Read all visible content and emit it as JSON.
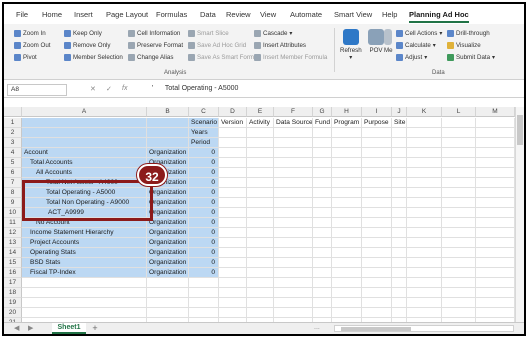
{
  "ribbon_tabs": [
    "File",
    "Home",
    "Insert",
    "Page Layout",
    "Formulas",
    "Data",
    "Review",
    "View",
    "Automate",
    "Smart View",
    "Help",
    "Planning Ad Hoc"
  ],
  "ribbon": {
    "analysis": {
      "zoom_in": "Zoom In",
      "zoom_out": "Zoom Out",
      "pivot": "Pivot",
      "keep_only": "Keep Only",
      "remove_only": "Remove Only",
      "member_selection": "Member Selection",
      "cell_information": "Cell Information",
      "preserve_format": "Preserve Format",
      "change_alias": "Change Alias",
      "smart_slice": "Smart Slice",
      "save_ad_hoc_grid": "Save Ad Hoc Grid",
      "save_as_smart_form": "Save As Smart Form",
      "cascade": "Cascade",
      "insert_attributes": "Insert Attributes",
      "insert_member_formula": "Insert Member Formula",
      "group_label": "Analysis"
    },
    "data": {
      "refresh": "Refresh",
      "pov": "POV",
      "me": "Me",
      "cell_actions": "Cell Actions",
      "calculate": "Calculate",
      "adjust": "Adjust",
      "drill_through": "Drill-through",
      "visualize": "Visualize",
      "submit_data": "Submit Data",
      "group_label": "Data"
    }
  },
  "formula_bar": {
    "name_box": "A8",
    "cancel": "✕",
    "enter": "✓",
    "fx": "fx",
    "content": "'      Total Operating - A5000"
  },
  "columns": [
    "A",
    "B",
    "C",
    "D",
    "E",
    "F",
    "G",
    "H",
    "I",
    "J",
    "K",
    "L",
    "M"
  ],
  "rows": [
    {
      "n": "1",
      "a": "",
      "b": "",
      "c": "Scenario",
      "d": "Version",
      "e": "Activity",
      "f": "Data Source",
      "g": "Fund",
      "h": "Program",
      "i": "Purpose",
      "j": "Site"
    },
    {
      "n": "2",
      "a": "",
      "b": "",
      "c": "Years"
    },
    {
      "n": "3",
      "a": "",
      "b": "",
      "c": "Period"
    },
    {
      "n": "4",
      "a": "Account",
      "b": "Organization",
      "c": "0"
    },
    {
      "n": "5",
      "a": "Total Accounts",
      "b": "Organization",
      "c": "0"
    },
    {
      "n": "6",
      "a": "All Accounts",
      "b": "Organization",
      "c": "0"
    },
    {
      "n": "7",
      "a": "Total Net Assets - A4900",
      "b": "Organization",
      "c": "0"
    },
    {
      "n": "8",
      "a": "Total Operating - A5000",
      "b": "Organization",
      "c": "0"
    },
    {
      "n": "9",
      "a": "Total Non Operating - A9000",
      "b": "Organization",
      "c": "0"
    },
    {
      "n": "10",
      "a": "ACT_A9999",
      "b": "Organization",
      "c": "0"
    },
    {
      "n": "11",
      "a": "No Account",
      "b": "Organization",
      "c": "0"
    },
    {
      "n": "12",
      "a": "Income Statement Hierarchy",
      "b": "Organization",
      "c": "0"
    },
    {
      "n": "13",
      "a": "Project Accounts",
      "b": "Organization",
      "c": "0"
    },
    {
      "n": "14",
      "a": "Operating Stats",
      "b": "Organization",
      "c": "0"
    },
    {
      "n": "15",
      "a": "BSD Stats",
      "b": "Organization",
      "c": "0"
    },
    {
      "n": "16",
      "a": "Fiscal TP-Index",
      "b": "Organization",
      "c": "0"
    },
    {
      "n": "17"
    },
    {
      "n": "18"
    },
    {
      "n": "19"
    },
    {
      "n": "20"
    },
    {
      "n": "21"
    }
  ],
  "callout": {
    "number": "32"
  },
  "sheet": {
    "name": "Sheet1",
    "add": "+",
    "ellipsis": "..."
  }
}
